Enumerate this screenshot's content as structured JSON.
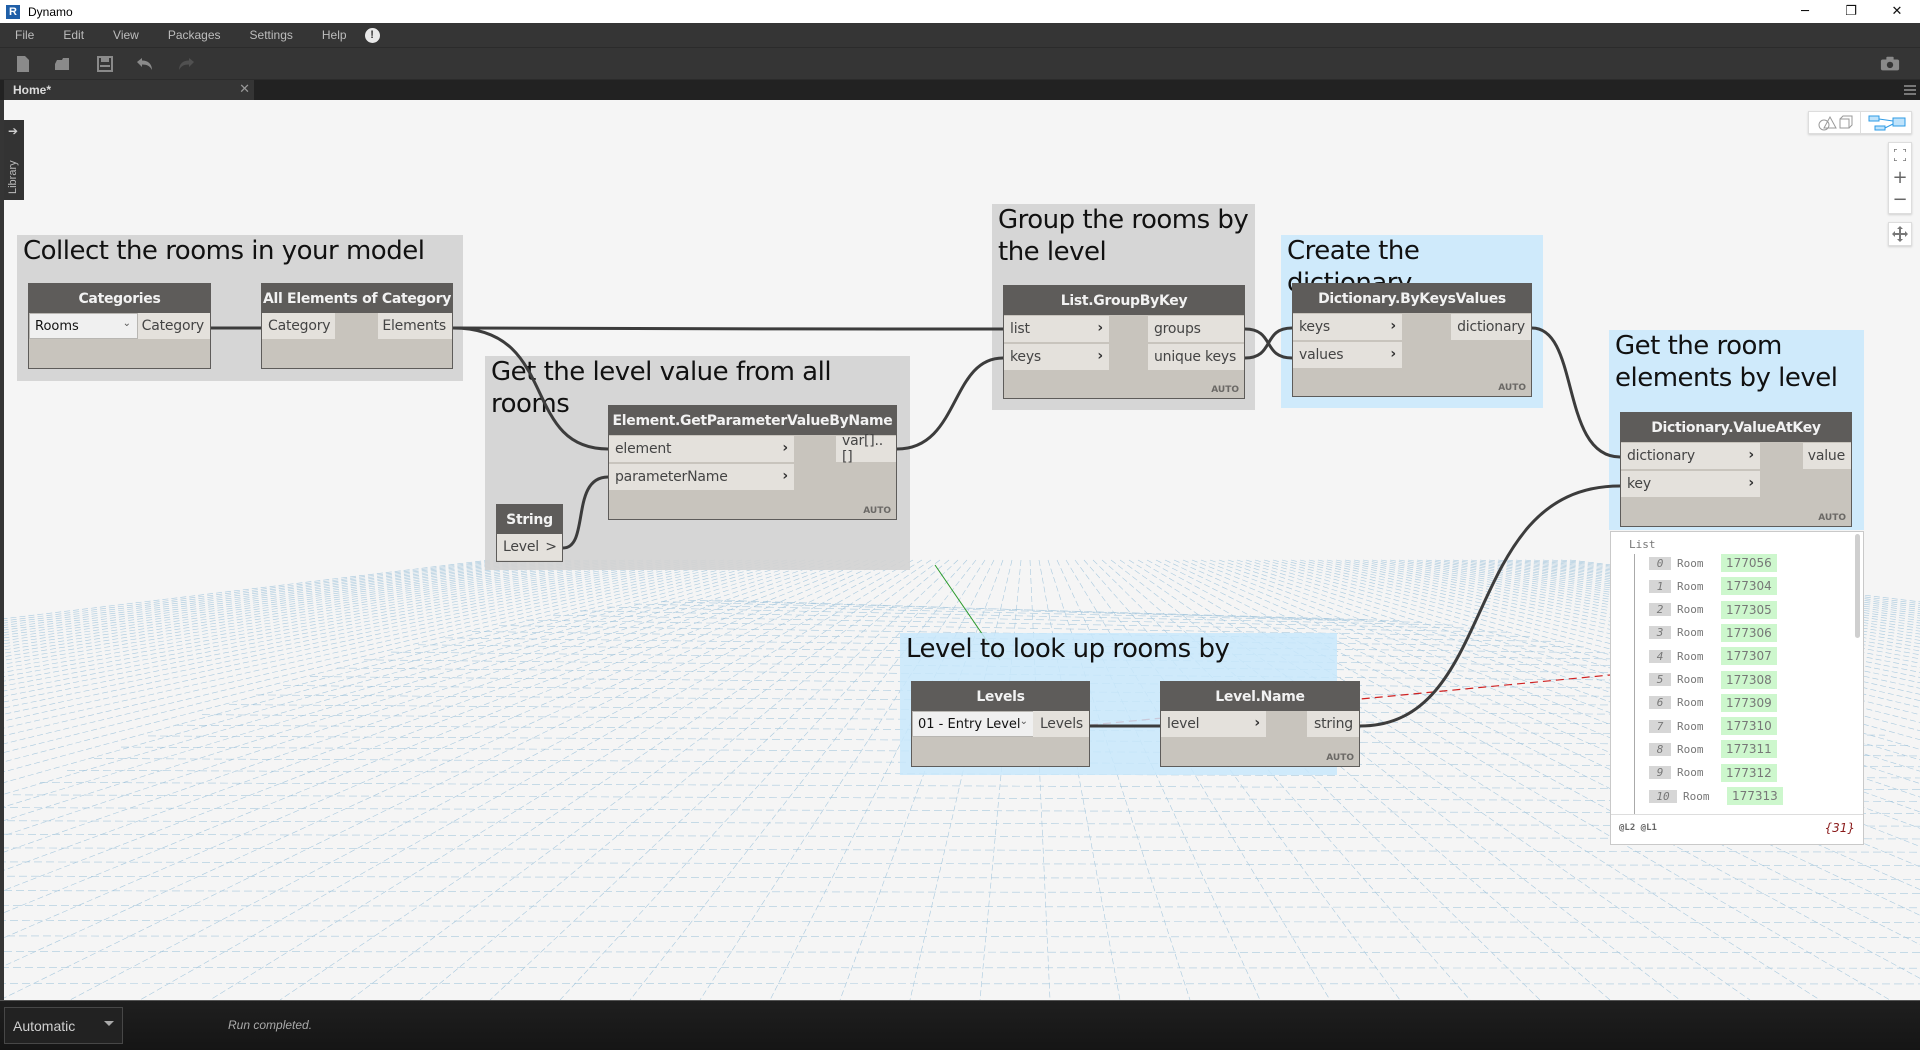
{
  "window": {
    "app_title": "Dynamo",
    "logo_letter": "R",
    "minimize_glyph": "─",
    "restore_glyph": "❐",
    "close_glyph": "✕"
  },
  "menu": {
    "items": [
      "File",
      "Edit",
      "View",
      "Packages",
      "Settings",
      "Help"
    ],
    "notification_glyph": "!"
  },
  "toolbar": {
    "buttons": [
      "new-file",
      "open-file",
      "save-file",
      "undo",
      "redo"
    ],
    "right_button": "camera-screenshot"
  },
  "tabs": {
    "active_tab": "Home*",
    "close_glyph": "✕"
  },
  "library_tab": {
    "label": "Library",
    "arrow_glyph": "➔"
  },
  "groups": [
    {
      "title": "Collect the rooms in your model",
      "color": "#d3d3d3"
    },
    {
      "title": "Get the level value from all rooms",
      "color": "#d3d3d3"
    },
    {
      "title_line1": "Group the rooms by",
      "title_line2": "the level",
      "color": "#d3d3d3"
    },
    {
      "title": "Create the dictionary",
      "color": "#c8e8fc"
    },
    {
      "title_line1": "Get the room",
      "title_line2": "elements by level",
      "color": "#c8e8fc"
    },
    {
      "title": "Level to look up rooms by",
      "color": "#c8e8fc"
    }
  ],
  "nodes": {
    "categories": {
      "title": "Categories",
      "selected": "Rooms",
      "output": "Category"
    },
    "all_elements": {
      "title": "All Elements of Category",
      "input": "Category",
      "output": "Elements"
    },
    "get_param": {
      "title": "Element.GetParameterValueByName",
      "inputs": [
        "element",
        "parameterName"
      ],
      "output": "var[]..[]",
      "lacing": "AUTO"
    },
    "string": {
      "title": "String",
      "value": "Level",
      "output_glyph": ">"
    },
    "group_by_key": {
      "title": "List.GroupByKey",
      "inputs": [
        "list",
        "keys"
      ],
      "outputs": [
        "groups",
        "unique keys"
      ],
      "lacing": "AUTO"
    },
    "by_keys_values": {
      "title": "Dictionary.ByKeysValues",
      "inputs": [
        "keys",
        "values"
      ],
      "output": "dictionary",
      "lacing": "AUTO"
    },
    "value_at_key": {
      "title": "Dictionary.ValueAtKey",
      "inputs": [
        "dictionary",
        "key"
      ],
      "output": "value",
      "lacing": "AUTO"
    },
    "levels": {
      "title": "Levels",
      "selected": "01 - Entry Level",
      "output": "Levels"
    },
    "level_name": {
      "title": "Level.Name",
      "input": "level",
      "output": "string",
      "lacing": "AUTO"
    }
  },
  "watch": {
    "header": "List",
    "items": [
      {
        "index": "0",
        "type": "Room",
        "id": "177056"
      },
      {
        "index": "1",
        "type": "Room",
        "id": "177304"
      },
      {
        "index": "2",
        "type": "Room",
        "id": "177305"
      },
      {
        "index": "3",
        "type": "Room",
        "id": "177306"
      },
      {
        "index": "4",
        "type": "Room",
        "id": "177307"
      },
      {
        "index": "5",
        "type": "Room",
        "id": "177308"
      },
      {
        "index": "6",
        "type": "Room",
        "id": "177309"
      },
      {
        "index": "7",
        "type": "Room",
        "id": "177310"
      },
      {
        "index": "8",
        "type": "Room",
        "id": "177311"
      },
      {
        "index": "9",
        "type": "Room",
        "id": "177312"
      },
      {
        "index": "10",
        "type": "Room",
        "id": "177313"
      }
    ],
    "levels": "@L2 @L1",
    "count": "{31}"
  },
  "view_controls": {
    "background_preview": "geometry-view",
    "graph_view": "graph-view-active",
    "zoom_fit": "fit-to-screen",
    "zoom_in": "+",
    "zoom_out": "−",
    "pan": "pan"
  },
  "status": {
    "run_mode": "Automatic",
    "message": "Run completed."
  },
  "colors": {
    "accent_blue": "#2e9be6",
    "node_header": "#5e5c5a",
    "watch_id_bg": "#cdf7cd",
    "count_color": "#8a1a1a"
  }
}
